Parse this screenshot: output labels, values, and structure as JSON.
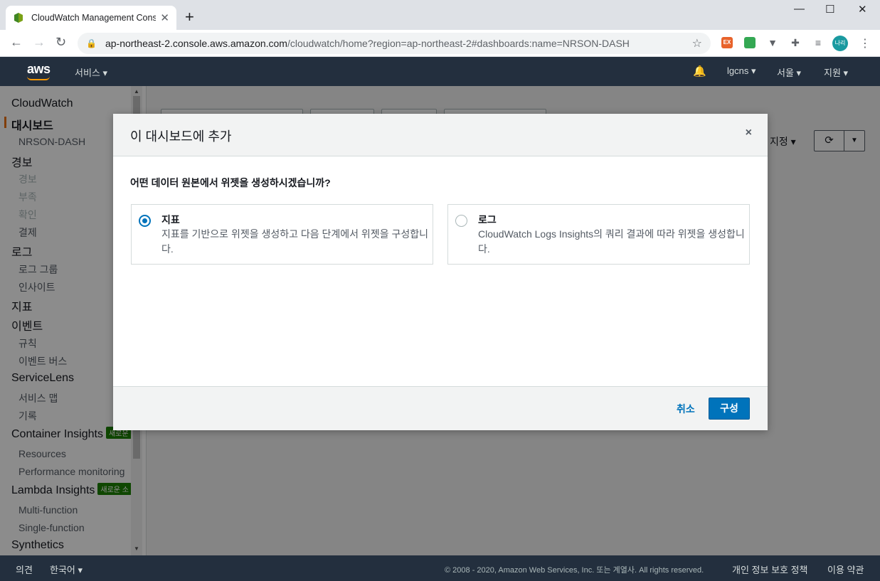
{
  "browser": {
    "tab_title": "CloudWatch Management Cons",
    "tab_close": "✕",
    "new_tab": "+",
    "url_host": "ap-northeast-2.console.aws.amazon.com",
    "url_path": "/cloudwatch/home?region=ap-northeast-2#dashboards:name=NRSON-DASH",
    "profile_initials": "나리",
    "window_controls": [
      "—",
      "☐",
      "✕"
    ]
  },
  "aws_nav": {
    "logo": "aws",
    "services": "서비스 ▾",
    "account": "lgcns ▾",
    "region": "서울 ▾",
    "support": "지원 ▾"
  },
  "sidebar": {
    "items": [
      {
        "label": "CloudWatch",
        "level": 1
      },
      {
        "label": "대시보드",
        "level": 1,
        "active": true
      },
      {
        "label": "NRSON-DASH",
        "level": 2
      },
      {
        "label": "경보",
        "level": 1
      },
      {
        "label": "경보",
        "level": 2,
        "disabled": true
      },
      {
        "label": "부족",
        "level": 2,
        "disabled": true
      },
      {
        "label": "확인",
        "level": 2,
        "disabled": true
      },
      {
        "label": "결제",
        "level": 2
      },
      {
        "label": "로그",
        "level": 1
      },
      {
        "label": "로그 그룹",
        "level": 2
      },
      {
        "label": "인사이트",
        "level": 2
      },
      {
        "label": "지표",
        "level": 1
      },
      {
        "label": "이벤트",
        "level": 1
      },
      {
        "label": "규칙",
        "level": 2
      },
      {
        "label": "이벤트 버스",
        "level": 2
      },
      {
        "label": "ServiceLens",
        "level": 1
      },
      {
        "label": "서비스 맵",
        "level": 2
      },
      {
        "label": "기록",
        "level": 2
      },
      {
        "label": "Container Insights",
        "level": 1,
        "badge": "새로운"
      },
      {
        "label": "Resources",
        "level": 2
      },
      {
        "label": "Performance monitoring",
        "level": 2
      },
      {
        "label": "Lambda Insights",
        "level": 1,
        "badge": "새로운 소"
      },
      {
        "label": "Multi-function",
        "level": 2
      },
      {
        "label": "Single-function",
        "level": 2
      },
      {
        "label": "Synthetics",
        "level": 1
      }
    ]
  },
  "main": {
    "custom_label": "지정 ▾"
  },
  "modal": {
    "title": "이 대시보드에 추가",
    "close": "×",
    "question": "어떤 데이터 원본에서 위젯을 생성하시겠습니까?",
    "options": [
      {
        "title": "지표",
        "desc": "지표를 기반으로 위젯을 생성하고 다음 단계에서 위젯을 구성합니다.",
        "selected": true
      },
      {
        "title": "로그",
        "desc": "CloudWatch Logs Insights의 쿼리 결과에 따라 위젯을 생성합니다.",
        "selected": false
      }
    ],
    "cancel": "취소",
    "confirm": "구성"
  },
  "footer": {
    "feedback": "의견",
    "language": "한국어 ▾",
    "copyright": "© 2008 - 2020, Amazon Web Services, Inc. 또는 계열사. All rights reserved.",
    "privacy": "개인 정보 보호 정책",
    "terms": "이용 약관"
  }
}
